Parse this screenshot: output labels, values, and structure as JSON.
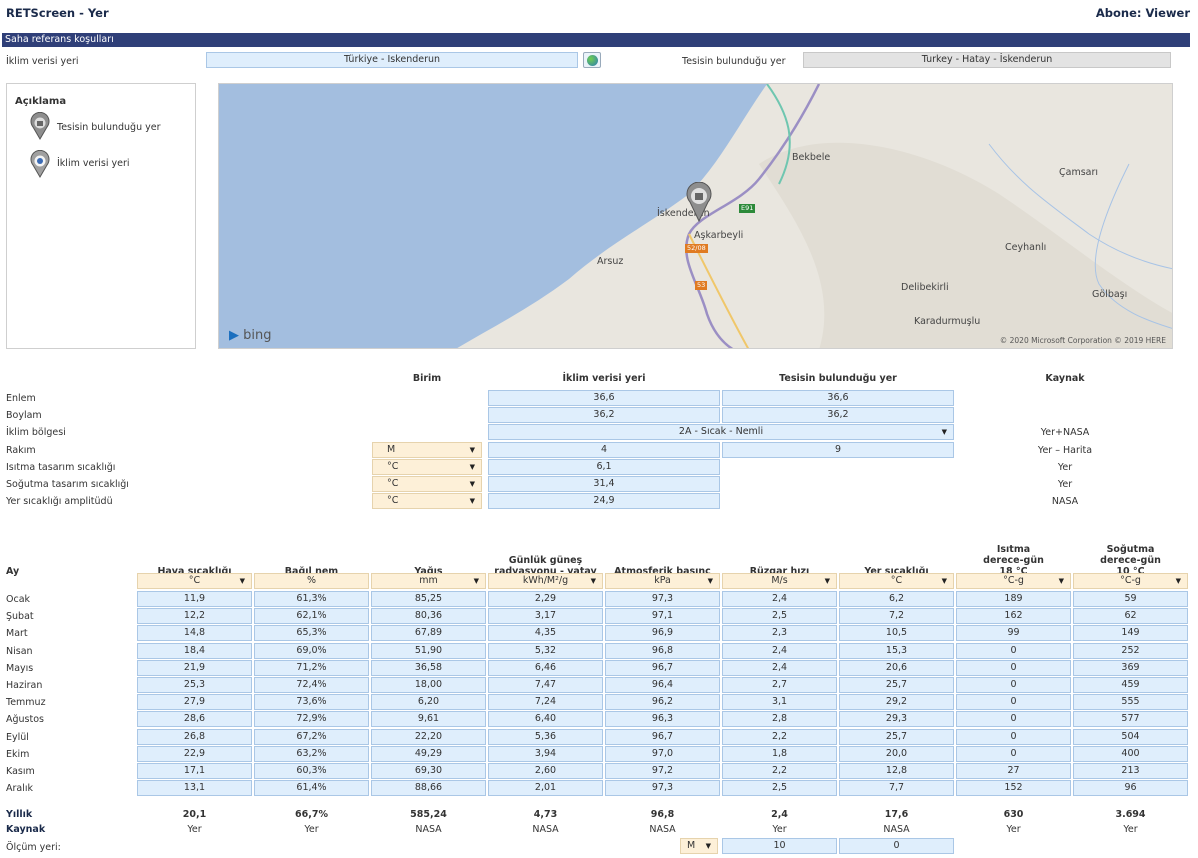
{
  "app": {
    "title": "RETScreen - Yer",
    "subscription": "Abone: Viewer",
    "section_title": "Saha referans koşulları"
  },
  "climate": {
    "label": "İklim verisi yeri",
    "value": "Türkiye - Iskenderun"
  },
  "facility": {
    "label": "Tesisin bulunduğu yer",
    "value": "Turkey - Hatay - İskenderun"
  },
  "legend": {
    "title": "Açıklama",
    "items": [
      "Tesisin bulunduğu yer",
      "İklim verisi yeri"
    ]
  },
  "map": {
    "places": [
      "Bekbele",
      "Çamsarı",
      "İskenderun",
      "Aşkarbeyli",
      "Arsuz",
      "Ceyhanlı",
      "Delibekirli",
      "Gölbaşı",
      "Karadurmuşlu"
    ],
    "roads": [
      "E91",
      "52/08",
      "53"
    ],
    "brand": "bing",
    "copyright": "© 2020 Microsoft Corporation © 2019 HERE"
  },
  "site": {
    "headers": [
      "Birim",
      "İklim verisi yeri",
      "Tesisin bulunduğu yer",
      "Kaynak"
    ],
    "rows": [
      {
        "label": "Enlem",
        "unit": "",
        "climate": "36,6",
        "facility": "36,6",
        "source": ""
      },
      {
        "label": "Boylam",
        "unit": "",
        "climate": "36,2",
        "facility": "36,2",
        "source": ""
      },
      {
        "label": "İklim bölgesi",
        "unit": "",
        "climate": "2A - Sıcak - Nemli",
        "facility": "",
        "source": "Yer+NASA"
      },
      {
        "label": "Rakım",
        "unit": "M",
        "climate": "4",
        "facility": "9",
        "source": "Yer – Harita"
      },
      {
        "label": "Isıtma tasarım sıcaklığı",
        "unit": "°C",
        "climate": "6,1",
        "facility": "",
        "source": "Yer"
      },
      {
        "label": "Soğutma tasarım sıcaklığı",
        "unit": "°C",
        "climate": "31,4",
        "facility": "",
        "source": "Yer"
      },
      {
        "label": "Yer sıcaklığı amplitüdü",
        "unit": "°C",
        "climate": "24,9",
        "facility": "",
        "source": "NASA"
      }
    ]
  },
  "monthly": {
    "month_header": "Ay",
    "headers": [
      [
        "Hava sıcaklığı"
      ],
      [
        "Bağıl nem"
      ],
      [
        "Yağış"
      ],
      [
        "Günlük güneş",
        "radyasyonu - yatay"
      ],
      [
        "Atmosferik basınç"
      ],
      [
        "Rüzgar hızı"
      ],
      [
        "Yer sıcaklığı"
      ],
      [
        "Isıtma",
        "derece-gün",
        "18 °C"
      ],
      [
        "Soğutma",
        "derece-gün",
        "10 °C"
      ]
    ],
    "units": [
      "°C",
      "%",
      "mm",
      "kWh/M²/g",
      "kPa",
      "M/s",
      "°C",
      "°C-g",
      "°C-g"
    ],
    "rows": [
      {
        "m": "Ocak",
        "v": [
          "11,9",
          "61,3%",
          "85,25",
          "2,29",
          "97,3",
          "2,4",
          "6,2",
          "189",
          "59"
        ]
      },
      {
        "m": "Şubat",
        "v": [
          "12,2",
          "62,1%",
          "80,36",
          "3,17",
          "97,1",
          "2,5",
          "7,2",
          "162",
          "62"
        ]
      },
      {
        "m": "Mart",
        "v": [
          "14,8",
          "65,3%",
          "67,89",
          "4,35",
          "96,9",
          "2,3",
          "10,5",
          "99",
          "149"
        ]
      },
      {
        "m": "Nisan",
        "v": [
          "18,4",
          "69,0%",
          "51,90",
          "5,32",
          "96,8",
          "2,4",
          "15,3",
          "0",
          "252"
        ]
      },
      {
        "m": "Mayıs",
        "v": [
          "21,9",
          "71,2%",
          "36,58",
          "6,46",
          "96,7",
          "2,4",
          "20,6",
          "0",
          "369"
        ]
      },
      {
        "m": "Haziran",
        "v": [
          "25,3",
          "72,4%",
          "18,00",
          "7,47",
          "96,4",
          "2,7",
          "25,7",
          "0",
          "459"
        ]
      },
      {
        "m": "Temmuz",
        "v": [
          "27,9",
          "73,6%",
          "6,20",
          "7,24",
          "96,2",
          "3,1",
          "29,2",
          "0",
          "555"
        ]
      },
      {
        "m": "Ağustos",
        "v": [
          "28,6",
          "72,9%",
          "9,61",
          "6,40",
          "96,3",
          "2,8",
          "29,3",
          "0",
          "577"
        ]
      },
      {
        "m": "Eylül",
        "v": [
          "26,8",
          "67,2%",
          "22,20",
          "5,36",
          "96,7",
          "2,2",
          "25,7",
          "0",
          "504"
        ]
      },
      {
        "m": "Ekim",
        "v": [
          "22,9",
          "63,2%",
          "49,29",
          "3,94",
          "97,0",
          "1,8",
          "20,0",
          "0",
          "400"
        ]
      },
      {
        "m": "Kasım",
        "v": [
          "17,1",
          "60,3%",
          "69,30",
          "2,60",
          "97,2",
          "2,2",
          "12,8",
          "27",
          "213"
        ]
      },
      {
        "m": "Aralık",
        "v": [
          "13,1",
          "61,4%",
          "88,66",
          "2,01",
          "97,3",
          "2,5",
          "7,7",
          "152",
          "96"
        ]
      }
    ],
    "annual": {
      "label": "Yıllık",
      "v": [
        "20,1",
        "66,7%",
        "585,24",
        "4,73",
        "96,8",
        "2,4",
        "17,6",
        "630",
        "3.694"
      ]
    },
    "source": {
      "label": "Kaynak",
      "v": [
        "Yer",
        "Yer",
        "NASA",
        "NASA",
        "NASA",
        "Yer",
        "NASA",
        "Yer",
        "Yer"
      ]
    },
    "measure": {
      "label": "Ölçüm yeri:",
      "unit": "M",
      "values": [
        "10",
        "0"
      ]
    }
  }
}
